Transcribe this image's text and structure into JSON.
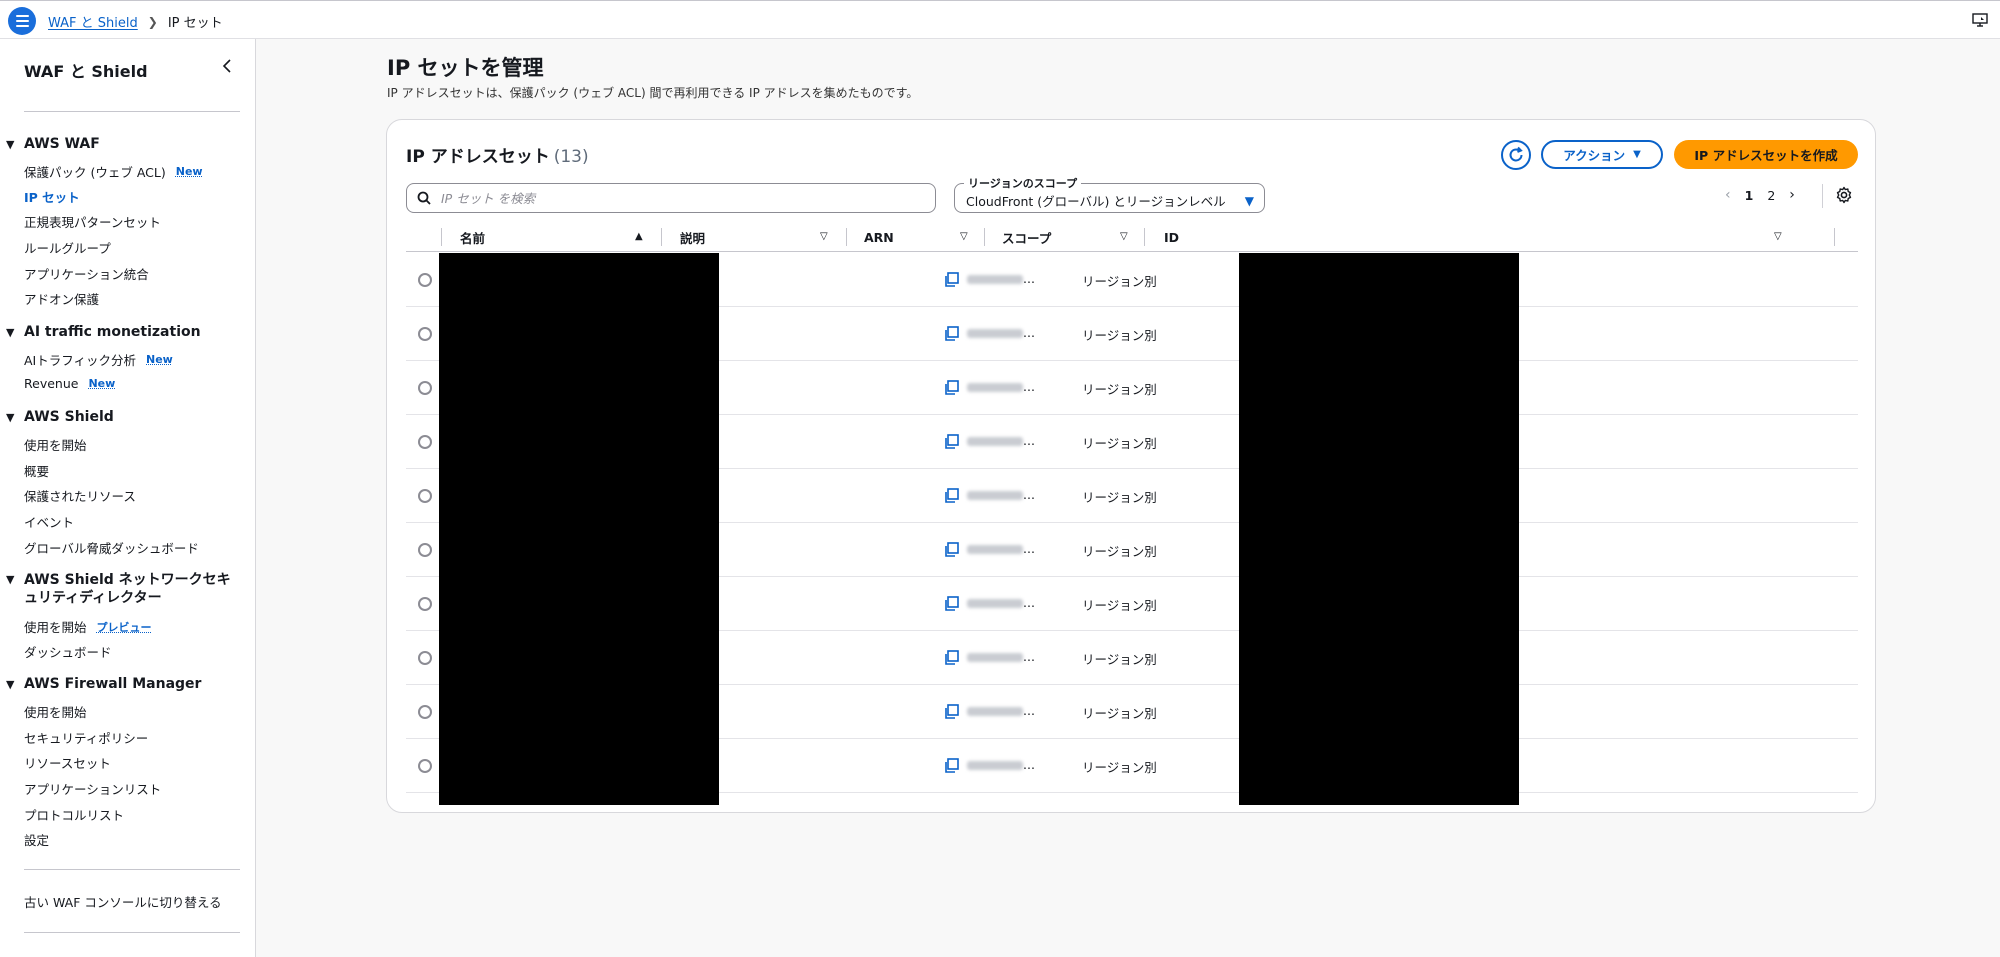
{
  "topbar": {
    "breadcrumbs": [
      {
        "label": "WAF と Shield"
      },
      {
        "label": "IP セット"
      }
    ]
  },
  "sidebar": {
    "title": "WAF と Shield",
    "sections": [
      {
        "label": "AWS WAF",
        "items": [
          {
            "label": "保護パック (ウェブ ACL)",
            "badge": "New"
          },
          {
            "label": "IP セット",
            "active": true
          },
          {
            "label": "正規表現パターンセット"
          },
          {
            "label": "ルールグループ"
          },
          {
            "label": "アプリケーション統合"
          },
          {
            "label": "アドオン保護"
          }
        ]
      },
      {
        "label": "AI traffic monetization",
        "items": [
          {
            "label": "AIトラフィック分析",
            "badge": "New"
          },
          {
            "label": "Revenue",
            "badge": "New"
          }
        ]
      },
      {
        "label": "AWS Shield",
        "items": [
          {
            "label": "使用を開始"
          },
          {
            "label": "概要"
          },
          {
            "label": "保護されたリソース"
          },
          {
            "label": "イベント"
          },
          {
            "label": "グローバル脅威ダッシュボード"
          }
        ]
      },
      {
        "label_line1": "AWS Shield ネットワークセキ",
        "label_line2": "ュリティディレクター",
        "items": [
          {
            "label": "使用を開始",
            "badge": "プレビュー"
          },
          {
            "label": "ダッシュボード"
          }
        ]
      },
      {
        "label": "AWS Firewall Manager",
        "items": [
          {
            "label": "使用を開始"
          },
          {
            "label": "セキュリティポリシー"
          },
          {
            "label": "リソースセット"
          },
          {
            "label": "アプリケーションリスト"
          },
          {
            "label": "プロトコルリスト"
          },
          {
            "label": "設定"
          }
        ]
      }
    ],
    "footer_link": "古い WAF コンソールに切り替える"
  },
  "main": {
    "title": "IP セットを管理",
    "description": "IP アドレスセットは、保護パック (ウェブ ACL) 間で再利用できる IP アドレスを集めたものです。",
    "panel": {
      "title": "IP アドレスセット",
      "count": "(13)",
      "actions_label": "アクション",
      "create_label": "IP アドレスセットを作成",
      "search_placeholder": "IP セット を検索",
      "scope_label": "リージョンのスコープ",
      "scope_value": "CloudFront (グローバル) とリージョンレベル",
      "pages": [
        "1",
        "2"
      ],
      "columns": [
        "名前",
        "説明",
        "ARN",
        "スコープ",
        "ID"
      ],
      "rows": [
        {
          "arn": "...",
          "scope": "リージョン別"
        },
        {
          "arn": "...",
          "scope": "リージョン別"
        },
        {
          "arn": "...",
          "scope": "リージョン別"
        },
        {
          "arn": "...",
          "scope": "リージョン別"
        },
        {
          "arn": "...",
          "scope": "リージョン別"
        },
        {
          "arn": "...",
          "scope": "リージョン別"
        },
        {
          "arn": "...",
          "scope": "リージョン別"
        },
        {
          "arn": "...",
          "scope": "リージョン別"
        },
        {
          "arn": "...",
          "scope": "リージョン別"
        },
        {
          "arn": "...",
          "scope": "リージョン別"
        }
      ]
    }
  },
  "colors": {
    "accent": "#0a62c9",
    "primary_button": "#ff9900",
    "redaction": "#000000"
  }
}
